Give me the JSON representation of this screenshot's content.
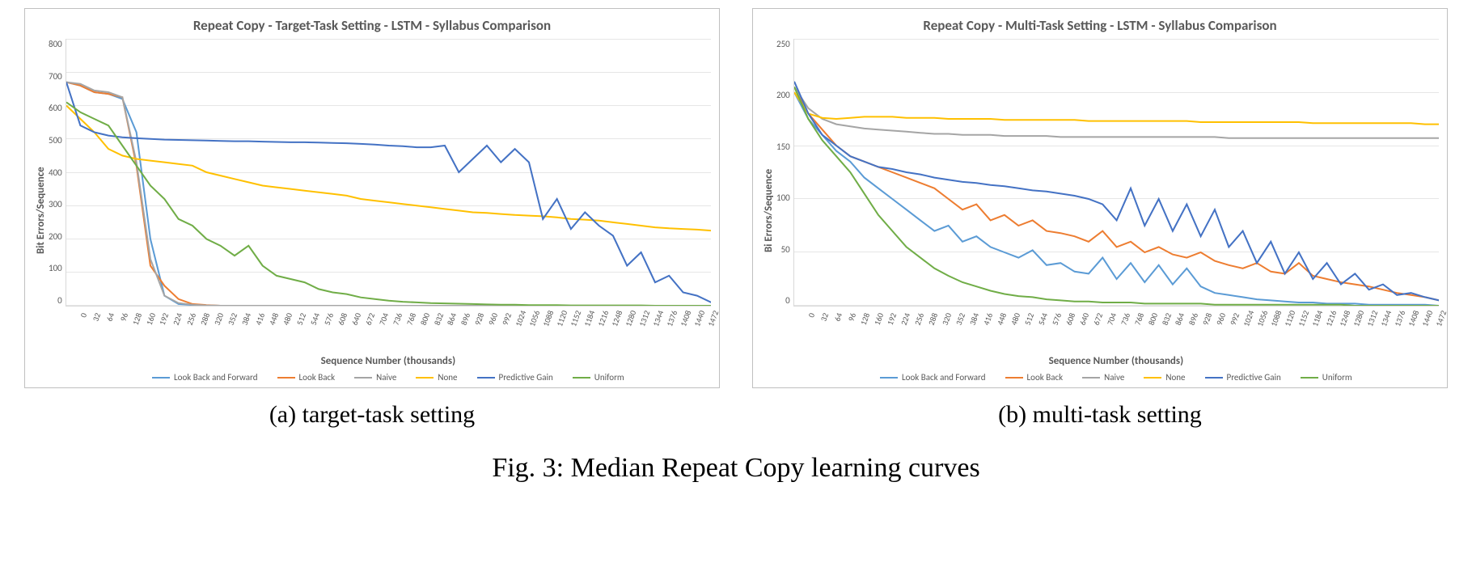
{
  "figure_caption": "Fig. 3: Median Repeat Copy learning curves",
  "subcaptions": {
    "a": "(a) target-task setting",
    "b": "(b) multi-task setting"
  },
  "series_meta": [
    {
      "name": "Look Back and Forward",
      "color": "#5b9bd5"
    },
    {
      "name": "Look Back",
      "color": "#ed7d31"
    },
    {
      "name": "Naive",
      "color": "#a5a5a5"
    },
    {
      "name": "None",
      "color": "#ffc000"
    },
    {
      "name": "Predictive Gain",
      "color": "#4472c4"
    },
    {
      "name": "Uniform",
      "color": "#70ad47"
    }
  ],
  "chart_data": [
    {
      "id": "a",
      "type": "line",
      "title": "Repeat Copy - Target-Task Setting - LSTM - Syllabus Comparison",
      "xlabel": "Sequence Number (thousands)",
      "ylabel": "Bit Errors/Sequence",
      "ylim": [
        0,
        800
      ],
      "yticks": [
        0,
        100,
        200,
        300,
        400,
        500,
        600,
        700,
        800
      ],
      "x": [
        0,
        32,
        64,
        96,
        128,
        160,
        192,
        224,
        256,
        288,
        320,
        352,
        384,
        416,
        448,
        480,
        512,
        544,
        576,
        608,
        640,
        672,
        704,
        736,
        768,
        800,
        832,
        864,
        896,
        928,
        960,
        992,
        1024,
        1056,
        1088,
        1120,
        1152,
        1184,
        1216,
        1248,
        1280,
        1312,
        1344,
        1376,
        1408,
        1440,
        1472
      ],
      "series": [
        {
          "name": "Look Back and Forward",
          "values": [
            670,
            660,
            640,
            635,
            620,
            520,
            200,
            30,
            5,
            2,
            1,
            0,
            0,
            0,
            0,
            0,
            0,
            0,
            0,
            0,
            0,
            0,
            0,
            0,
            0,
            0,
            0,
            0,
            0,
            0,
            0,
            0,
            0,
            0,
            0,
            0,
            0,
            0,
            0,
            0,
            0,
            0,
            0,
            0,
            0,
            0,
            0
          ]
        },
        {
          "name": "Look Back",
          "values": [
            670,
            660,
            640,
            635,
            625,
            420,
            120,
            60,
            20,
            5,
            2,
            0,
            0,
            0,
            0,
            0,
            0,
            0,
            0,
            0,
            0,
            0,
            0,
            0,
            0,
            0,
            0,
            0,
            0,
            0,
            0,
            0,
            0,
            0,
            0,
            0,
            0,
            0,
            0,
            0,
            0,
            0,
            0,
            0,
            0,
            0,
            0
          ]
        },
        {
          "name": "Naive",
          "values": [
            670,
            665,
            645,
            640,
            625,
            430,
            140,
            30,
            8,
            3,
            1,
            0,
            0,
            0,
            0,
            0,
            0,
            0,
            0,
            0,
            0,
            0,
            0,
            0,
            0,
            0,
            0,
            0,
            0,
            0,
            0,
            0,
            0,
            0,
            0,
            0,
            0,
            0,
            0,
            0,
            0,
            0,
            0,
            0,
            0,
            0,
            0
          ]
        },
        {
          "name": "None",
          "values": [
            600,
            560,
            520,
            470,
            450,
            440,
            435,
            430,
            425,
            420,
            400,
            390,
            380,
            370,
            360,
            355,
            350,
            345,
            340,
            335,
            330,
            320,
            315,
            310,
            305,
            300,
            295,
            290,
            285,
            280,
            278,
            275,
            272,
            270,
            268,
            265,
            260,
            258,
            255,
            250,
            245,
            240,
            235,
            232,
            230,
            228,
            225
          ]
        },
        {
          "name": "Predictive Gain",
          "values": [
            670,
            540,
            520,
            510,
            505,
            502,
            500,
            498,
            497,
            496,
            495,
            494,
            493,
            493,
            492,
            491,
            490,
            490,
            489,
            488,
            487,
            485,
            483,
            480,
            478,
            475,
            475,
            480,
            400,
            440,
            480,
            430,
            470,
            430,
            260,
            320,
            230,
            280,
            240,
            210,
            120,
            160,
            70,
            90,
            40,
            30,
            10
          ]
        },
        {
          "name": "Uniform",
          "values": [
            610,
            580,
            560,
            540,
            480,
            420,
            360,
            320,
            260,
            240,
            200,
            180,
            150,
            180,
            120,
            90,
            80,
            70,
            50,
            40,
            35,
            25,
            20,
            15,
            12,
            10,
            8,
            7,
            6,
            5,
            4,
            3,
            3,
            2,
            2,
            2,
            1,
            1,
            1,
            1,
            1,
            1,
            0,
            0,
            0,
            0,
            0
          ]
        }
      ]
    },
    {
      "id": "b",
      "type": "line",
      "title": "Repeat Copy - Multi-Task Setting - LSTM - Syllabus Comparison",
      "xlabel": "Sequence Number (thousands)",
      "ylabel": "Bi Errors/Sequence",
      "ylim": [
        0,
        250
      ],
      "yticks": [
        0,
        50,
        100,
        150,
        200,
        250
      ],
      "x": [
        0,
        32,
        64,
        96,
        128,
        160,
        192,
        224,
        256,
        288,
        320,
        352,
        384,
        416,
        448,
        480,
        512,
        544,
        576,
        608,
        640,
        672,
        704,
        736,
        768,
        800,
        832,
        864,
        896,
        928,
        960,
        992,
        1024,
        1056,
        1088,
        1120,
        1152,
        1184,
        1216,
        1248,
        1280,
        1312,
        1344,
        1376,
        1408,
        1440,
        1472
      ],
      "series": [
        {
          "name": "Look Back and Forward",
          "values": [
            200,
            175,
            160,
            145,
            135,
            120,
            110,
            100,
            90,
            80,
            70,
            75,
            60,
            65,
            55,
            50,
            45,
            52,
            38,
            40,
            32,
            30,
            45,
            25,
            40,
            22,
            38,
            20,
            35,
            18,
            12,
            10,
            8,
            6,
            5,
            4,
            3,
            3,
            2,
            2,
            2,
            1,
            1,
            1,
            1,
            1,
            0
          ]
        },
        {
          "name": "Look Back",
          "values": [
            205,
            180,
            165,
            150,
            140,
            135,
            130,
            125,
            120,
            115,
            110,
            100,
            90,
            95,
            80,
            85,
            75,
            80,
            70,
            68,
            65,
            60,
            70,
            55,
            60,
            50,
            55,
            48,
            45,
            50,
            42,
            38,
            35,
            40,
            32,
            30,
            40,
            28,
            25,
            22,
            20,
            18,
            15,
            12,
            10,
            8,
            5
          ]
        },
        {
          "name": "Naive",
          "values": [
            205,
            185,
            175,
            170,
            168,
            166,
            165,
            164,
            163,
            162,
            161,
            161,
            160,
            160,
            160,
            159,
            159,
            159,
            159,
            158,
            158,
            158,
            158,
            158,
            158,
            158,
            158,
            158,
            158,
            158,
            158,
            157,
            157,
            157,
            157,
            157,
            157,
            157,
            157,
            157,
            157,
            157,
            157,
            157,
            157,
            157,
            157
          ]
        },
        {
          "name": "None",
          "values": [
            200,
            180,
            176,
            175,
            176,
            177,
            177,
            177,
            176,
            176,
            176,
            175,
            175,
            175,
            175,
            174,
            174,
            174,
            174,
            174,
            174,
            173,
            173,
            173,
            173,
            173,
            173,
            173,
            173,
            172,
            172,
            172,
            172,
            172,
            172,
            172,
            172,
            171,
            171,
            171,
            171,
            171,
            171,
            171,
            171,
            170,
            170
          ]
        },
        {
          "name": "Predictive Gain",
          "values": [
            210,
            180,
            160,
            150,
            140,
            135,
            130,
            128,
            125,
            123,
            120,
            118,
            116,
            115,
            113,
            112,
            110,
            108,
            107,
            105,
            103,
            100,
            95,
            80,
            110,
            75,
            100,
            70,
            95,
            65,
            90,
            55,
            70,
            40,
            60,
            30,
            50,
            25,
            40,
            20,
            30,
            15,
            20,
            10,
            12,
            8,
            5
          ]
        },
        {
          "name": "Uniform",
          "values": [
            205,
            175,
            155,
            140,
            125,
            105,
            85,
            70,
            55,
            45,
            35,
            28,
            22,
            18,
            14,
            11,
            9,
            8,
            6,
            5,
            4,
            4,
            3,
            3,
            3,
            2,
            2,
            2,
            2,
            2,
            1,
            1,
            1,
            1,
            1,
            1,
            1,
            1,
            1,
            1,
            0,
            0,
            0,
            0,
            0,
            0,
            0
          ]
        }
      ]
    }
  ]
}
